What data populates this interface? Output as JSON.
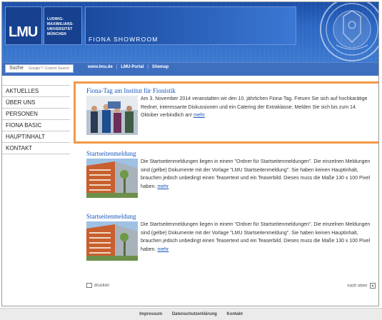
{
  "header": {
    "logo_text": "LMU",
    "university_name": [
      "LUDWIG-",
      "MAXIMILIANS-",
      "UNIVERSITÄT",
      "MÜNCHEN"
    ],
    "site_title": "FIONA SHOWROOM"
  },
  "search": {
    "label": "Suche",
    "placeholder": "Google™ Custom Search"
  },
  "navbar": {
    "links": [
      "www.lmu.de",
      "LMU-Portal",
      "Sitemap"
    ]
  },
  "sidebar": {
    "items": [
      "AKTUELLES",
      "ÜBER UNS",
      "PERSONEN",
      "FIONA BASIC",
      "HAUPTINHALT",
      "KONTAKT"
    ]
  },
  "articles": [
    {
      "title": "Fiona-Tag am Institut für Fionistik",
      "text": "Am 3. November 2014 veranstalten wir den 10. jährlichen Fiona-Tag. Freuen Sie sich auf hochkarätige Redner, interessante Diskussionen und ein Catering der Extraklasse. Melden Sie sich bis zum 14. Oktober verbindlich an!",
      "more": "mehr"
    },
    {
      "title": "Startseitenmeldung",
      "text": "Die Startseitenmeldungen liegen in einem \"Ordner für Startseitenmeldungen\". Die einzelnen Meldungen sind (gelbe) Dokumente mit der Vorlage \"LMU Startseitenmeldung\". Sie haben keinen Hauptinhalt, brauchen jedoch unbedingt einen Teasertext und ein Teaserbild. Dieses muss die Maße 130 x 100 Pixel haben.",
      "more": "mehr"
    },
    {
      "title": "Startseitenmeldung",
      "text": "Die Startseitenmeldungen liegen in einem \"Ordner für Startseitenmeldungen\". Die einzelnen Meldungen sind (gelbe) Dokumente mit der Vorlage \"LMU Startseitenmeldung\". Sie haben keinen Hauptinhalt, brauchen jedoch unbedingt einen Teasertext und ein Teaserbild. Dieses muss die Maße 130 x 100 Pixel haben.",
      "more": "mehr"
    }
  ],
  "footer": {
    "print": "drucken",
    "top": "nach oben"
  },
  "bottom_links": [
    "Impressum",
    "Datenschutzerklärung",
    "Kontakt"
  ],
  "colors": {
    "header_blue": "#2b67c4",
    "link_blue": "#1656b8",
    "highlight_orange": "#f19a43"
  }
}
